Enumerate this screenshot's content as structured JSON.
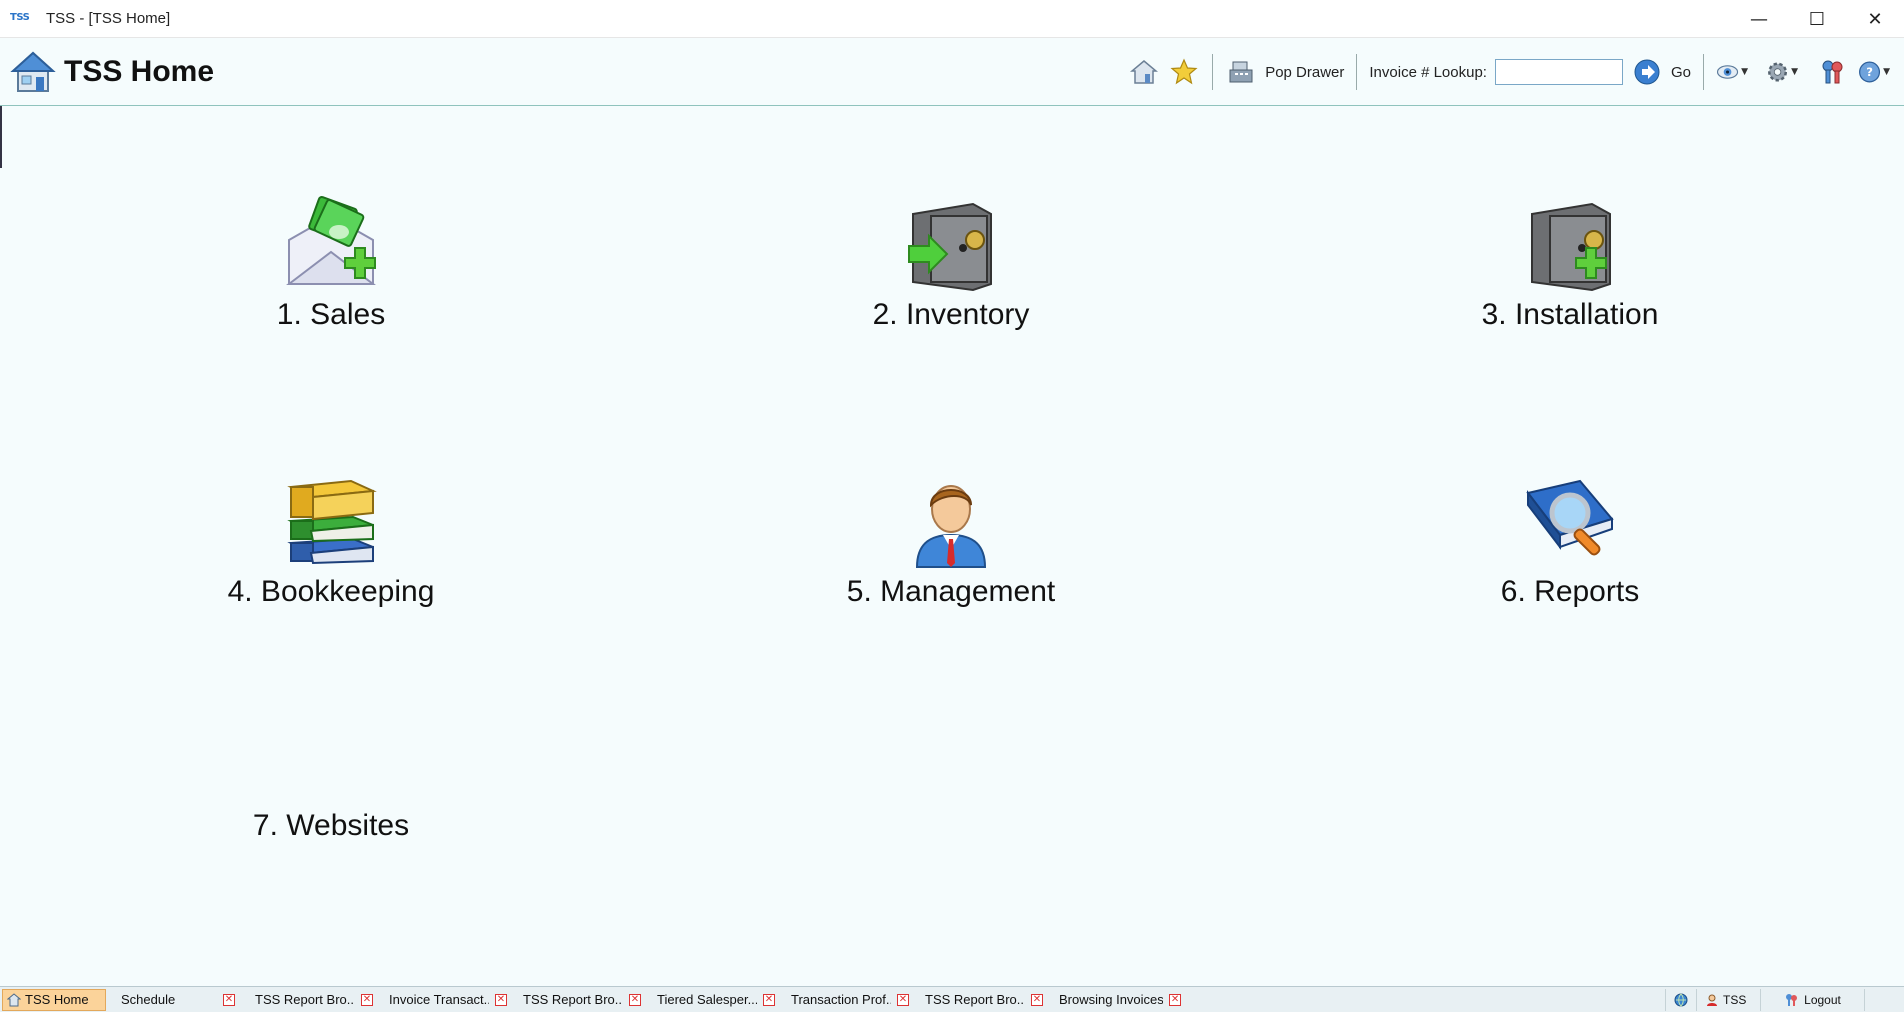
{
  "window": {
    "badge": "TSS",
    "title": "TSS - [TSS Home]",
    "minimize": "—",
    "maximize": "☐",
    "close": "✕"
  },
  "header": {
    "title": "TSS Home",
    "pop_drawer_label": "Pop Drawer",
    "invoice_lookup_label": "Invoice # Lookup:",
    "invoice_lookup_value": "",
    "go_label": "Go"
  },
  "menu": {
    "sales": "1. Sales",
    "inventory": "2. Inventory",
    "installation": "3. Installation",
    "bookkeeping": "4. Bookkeeping",
    "management": "5. Management",
    "reports": "6. Reports",
    "websites": "7. Websites"
  },
  "taskbar": {
    "tabs": [
      {
        "label": "TSS Home",
        "active": true
      },
      {
        "label": "Schedule"
      },
      {
        "label": "TSS Report Bro..."
      },
      {
        "label": "Invoice Transact..."
      },
      {
        "label": "TSS Report Bro..."
      },
      {
        "label": "Tiered Salesper..."
      },
      {
        "label": "Transaction Prof..."
      },
      {
        "label": "TSS Report Bro..."
      },
      {
        "label": "Browsing Invoices"
      }
    ],
    "user": "TSS",
    "logout": "Logout"
  },
  "colors": {
    "background": "#f5fcfd",
    "active_tab": "#fbd39a",
    "close_red": "#dd3333",
    "accent_blue": "#2a74c8"
  }
}
